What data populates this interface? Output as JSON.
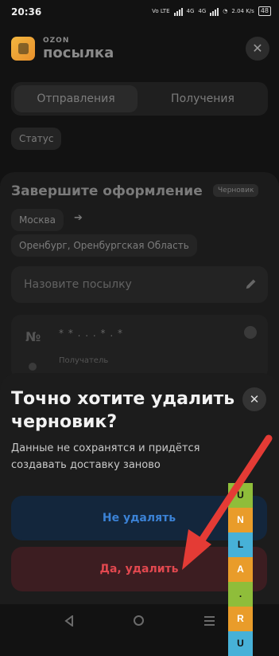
{
  "status_bar": {
    "time": "20:36",
    "net1": "Vo LTE",
    "net2": "4G",
    "net3": "4G",
    "speed": "2.04 K/s",
    "battery": "48"
  },
  "header": {
    "brand_small": "OZON",
    "brand_big": "посылка",
    "close_icon": "close-icon"
  },
  "tabs": [
    {
      "label": "Отправления",
      "active": true
    },
    {
      "label": "Получения",
      "active": false
    }
  ],
  "filter": {
    "status_label": "Статус"
  },
  "draft_card": {
    "title": "Завершите оформление",
    "badge": "Черновик",
    "from_city": "Москва",
    "to_city": "Оренбург, Оренбургская Область",
    "name_placeholder": "Назовите посылку",
    "track_prefix": "№",
    "track_masked": "* * . . . * . *",
    "recipient_label": "Получатель"
  },
  "dialog": {
    "title": "Точно хотите удалить черновик?",
    "description": "Данные не сохранятся и придётся создавать доставку заново",
    "keep_button": "Не удалять",
    "delete_button": "Да, удалить"
  },
  "watermark": {
    "letters": [
      "U",
      "N",
      "L",
      "A",
      ".",
      "R",
      "U"
    ],
    "colors": [
      "#8fbd3a",
      "#e99c2a",
      "#47b1d8",
      "#e99c2a",
      "#8fbd3a",
      "#e99c2a",
      "#47b1d8"
    ]
  },
  "colors": {
    "accent_blue": "#3b82d6",
    "danger_red": "#e2484f",
    "annotation_arrow": "#e43b35"
  }
}
